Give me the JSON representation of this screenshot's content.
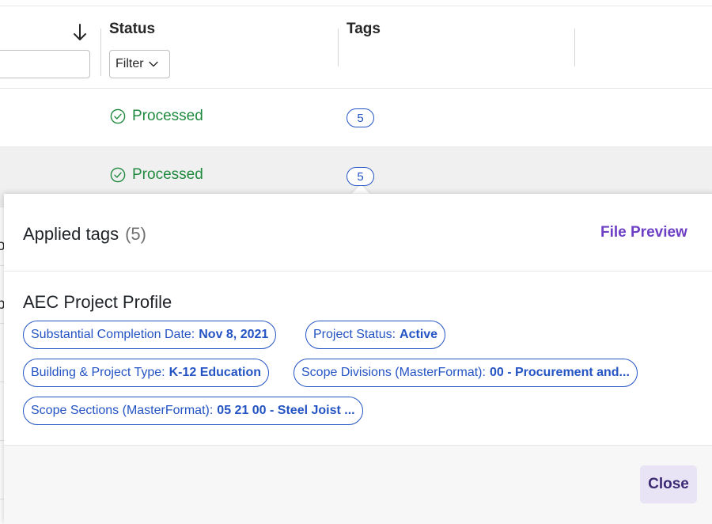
{
  "table": {
    "columns": [
      {
        "title": "Status"
      },
      {
        "title": "Tags"
      }
    ],
    "status_filter_label": "Filter",
    "rows": [
      {
        "status": "Processed",
        "tags_count": "5"
      },
      {
        "status": "Processed",
        "tags_count": "5"
      }
    ],
    "side_fragments": [
      "o",
      "p"
    ]
  },
  "popover": {
    "title": "Applied tags",
    "count": "(5)",
    "file_preview_label": "File Preview",
    "group_title": "AEC Project Profile",
    "tags": [
      {
        "key": "Substantial Completion Date:",
        "value": "Nov 8, 2021"
      },
      {
        "key": "Project Status:",
        "value": "Active"
      },
      {
        "key": "Building & Project Type:",
        "value": "K-12 Education"
      },
      {
        "key": "Scope Divisions (MasterFormat):",
        "value": "00 - Procurement and..."
      },
      {
        "key": "Scope Sections (MasterFormat):",
        "value": "05 21 00 - Steel Joist ..."
      }
    ],
    "close_label": "Close"
  },
  "colors": {
    "processed_green": "#1f8a3f",
    "tag_blue": "#2454c4",
    "link_purple": "#6c3fc5",
    "close_bg": "#e9e4f5"
  }
}
